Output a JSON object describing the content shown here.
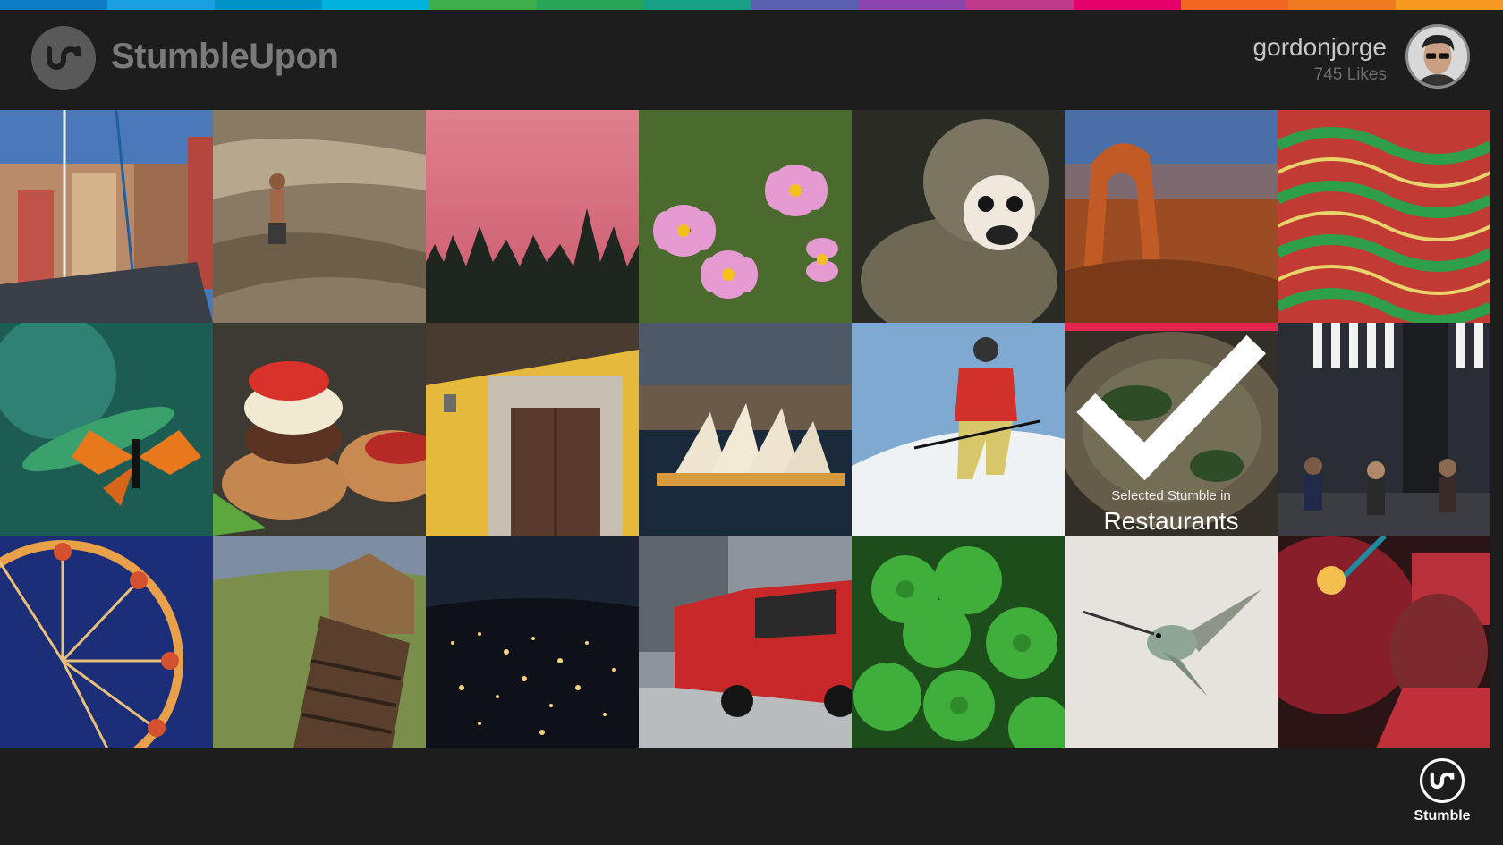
{
  "app": {
    "name": "StumbleUpon"
  },
  "user": {
    "username": "gordonjorge",
    "likes": "745 Likes"
  },
  "stripe_colors": [
    "#0e7cc4",
    "#1aa0e0",
    "#0094c9",
    "#00b2de",
    "#3dae49",
    "#29a55a",
    "#16a085",
    "#5a5fb0",
    "#8e44ad",
    "#c03b8c",
    "#e5006a",
    "#f26522",
    "#f07a1f",
    "#f79a1f"
  ],
  "selected_tile": {
    "caption_small": "Selected Stumble in",
    "caption_big": "Restaurants",
    "accent": "#e2254f"
  },
  "tiles": [
    {
      "name": "tile-harbor-sailboat"
    },
    {
      "name": "tile-rock-climber"
    },
    {
      "name": "tile-pink-sky-forest"
    },
    {
      "name": "tile-pink-cosmos-flowers"
    },
    {
      "name": "tile-squirrel-monkey"
    },
    {
      "name": "tile-desert-arch"
    },
    {
      "name": "tile-painted-pattern"
    },
    {
      "name": "tile-butterfly"
    },
    {
      "name": "tile-burger"
    },
    {
      "name": "tile-yellow-building-door"
    },
    {
      "name": "tile-sydney-opera-house"
    },
    {
      "name": "tile-skier"
    },
    {
      "name": "tile-selected-restaurants"
    },
    {
      "name": "tile-outdoor-cafe"
    },
    {
      "name": "tile-ferris-wheel"
    },
    {
      "name": "tile-old-barn"
    },
    {
      "name": "tile-city-night"
    },
    {
      "name": "tile-red-car"
    },
    {
      "name": "tile-clover"
    },
    {
      "name": "tile-hummingbird"
    },
    {
      "name": "tile-red-light-portrait"
    }
  ],
  "stumble_button": {
    "label": "Stumble"
  }
}
